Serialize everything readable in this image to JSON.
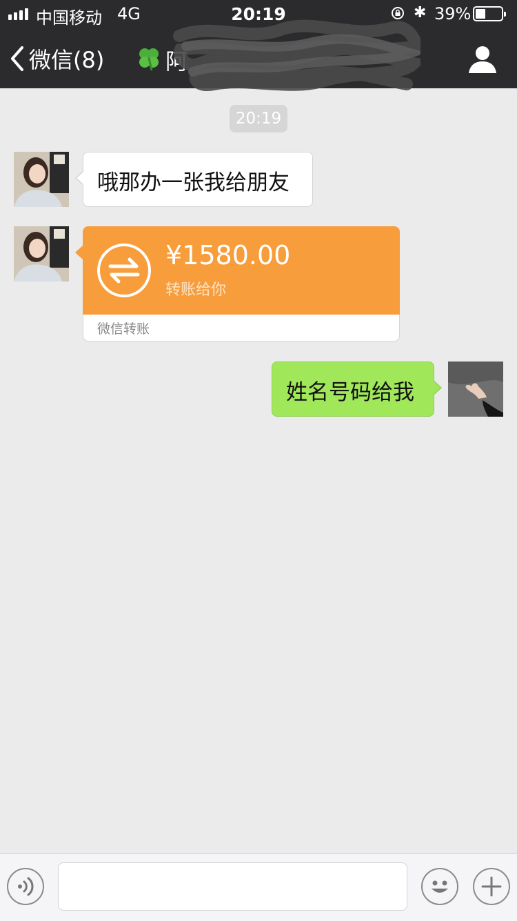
{
  "status_bar": {
    "carrier": "中国移动",
    "network": "4G",
    "time": "20:19",
    "battery_percent": "39%",
    "battery_level": 0.39
  },
  "nav": {
    "back_label": "微信(8)",
    "title_partial": "阿"
  },
  "chat": {
    "timestamp": "20:19",
    "messages": [
      {
        "from": "contact",
        "text": "哦那办一张我给朋友"
      },
      {
        "from": "contact",
        "type": "transfer",
        "amount": "¥1580.00",
        "note": "转账给你",
        "brand": "微信转账"
      },
      {
        "from": "me",
        "text": "姓名号码给我"
      }
    ]
  },
  "colors": {
    "header_bg": "#2b2b2e",
    "chat_bg": "#ebebeb",
    "outgoing_bubble": "#a0e75a",
    "transfer_orange": "#f89d3b"
  },
  "icons": {
    "back": "chevron-left-icon",
    "profile": "person-icon",
    "voice": "voice-icon",
    "emoji": "emoji-icon",
    "add": "plus-icon"
  }
}
